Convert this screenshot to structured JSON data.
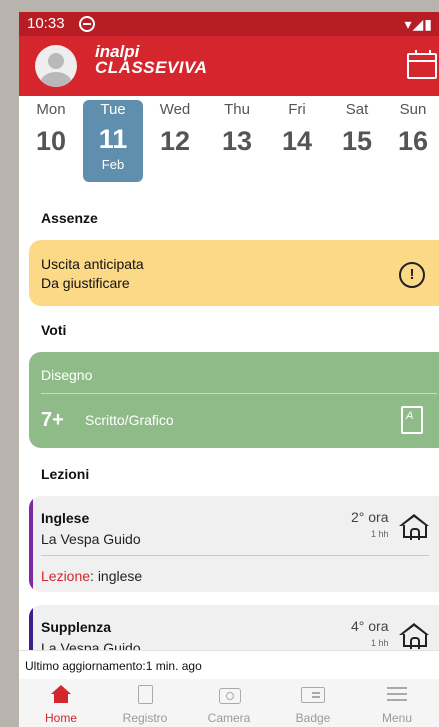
{
  "status_bar": {
    "time": "10:33",
    "signal": "▾◢▮"
  },
  "app": {
    "logo_line1": "inalpi",
    "logo_line2": "CLASSEVIVA"
  },
  "week": {
    "days": [
      {
        "name": "Mon",
        "num": "10"
      },
      {
        "name": "Tue",
        "num": "11",
        "month": "Feb",
        "selected": true
      },
      {
        "name": "Wed",
        "num": "12"
      },
      {
        "name": "Thu",
        "num": "13"
      },
      {
        "name": "Fri",
        "num": "14"
      },
      {
        "name": "Sat",
        "num": "15"
      },
      {
        "name": "Sun",
        "num": "16"
      }
    ]
  },
  "absences": {
    "title": "Assenze",
    "card": {
      "type": "Uscita anticipata",
      "status": "Da giustificare",
      "icon": "warning-icon",
      "color": "#fbd987"
    }
  },
  "grades": {
    "title": "Voti",
    "card": {
      "subject": "Disegno",
      "value": "7+",
      "type": "Scritto/Grafico",
      "icon": "grade-document-icon",
      "color": "#8fbb88"
    }
  },
  "lessons": {
    "title": "Lezioni",
    "items": [
      {
        "subject": "Inglese",
        "teacher": "La Vespa Guido",
        "hour": "2° ora",
        "duration": "1 hh",
        "topic_label": "Lezione",
        "topic": ": inglese",
        "accent": "#7b2aa3"
      },
      {
        "subject": "Supplenza",
        "teacher": "La Vespa Guido",
        "hour": "4° ora",
        "duration": "1 hh",
        "accent": "#3b1f8f"
      }
    ]
  },
  "update_text": "Ultimo aggiornamento:1 min. ago",
  "nav": {
    "items": [
      {
        "label": "Home",
        "icon": "home-icon",
        "active": true
      },
      {
        "label": "Registro",
        "icon": "book-icon"
      },
      {
        "label": "Camera",
        "icon": "camera-icon"
      },
      {
        "label": "Badge",
        "icon": "badge-icon"
      },
      {
        "label": "Menu",
        "icon": "menu-icon"
      }
    ]
  },
  "colors": {
    "primary": "#d5262e",
    "status_bar": "#b81c24",
    "selected_day": "#5f8fad"
  }
}
